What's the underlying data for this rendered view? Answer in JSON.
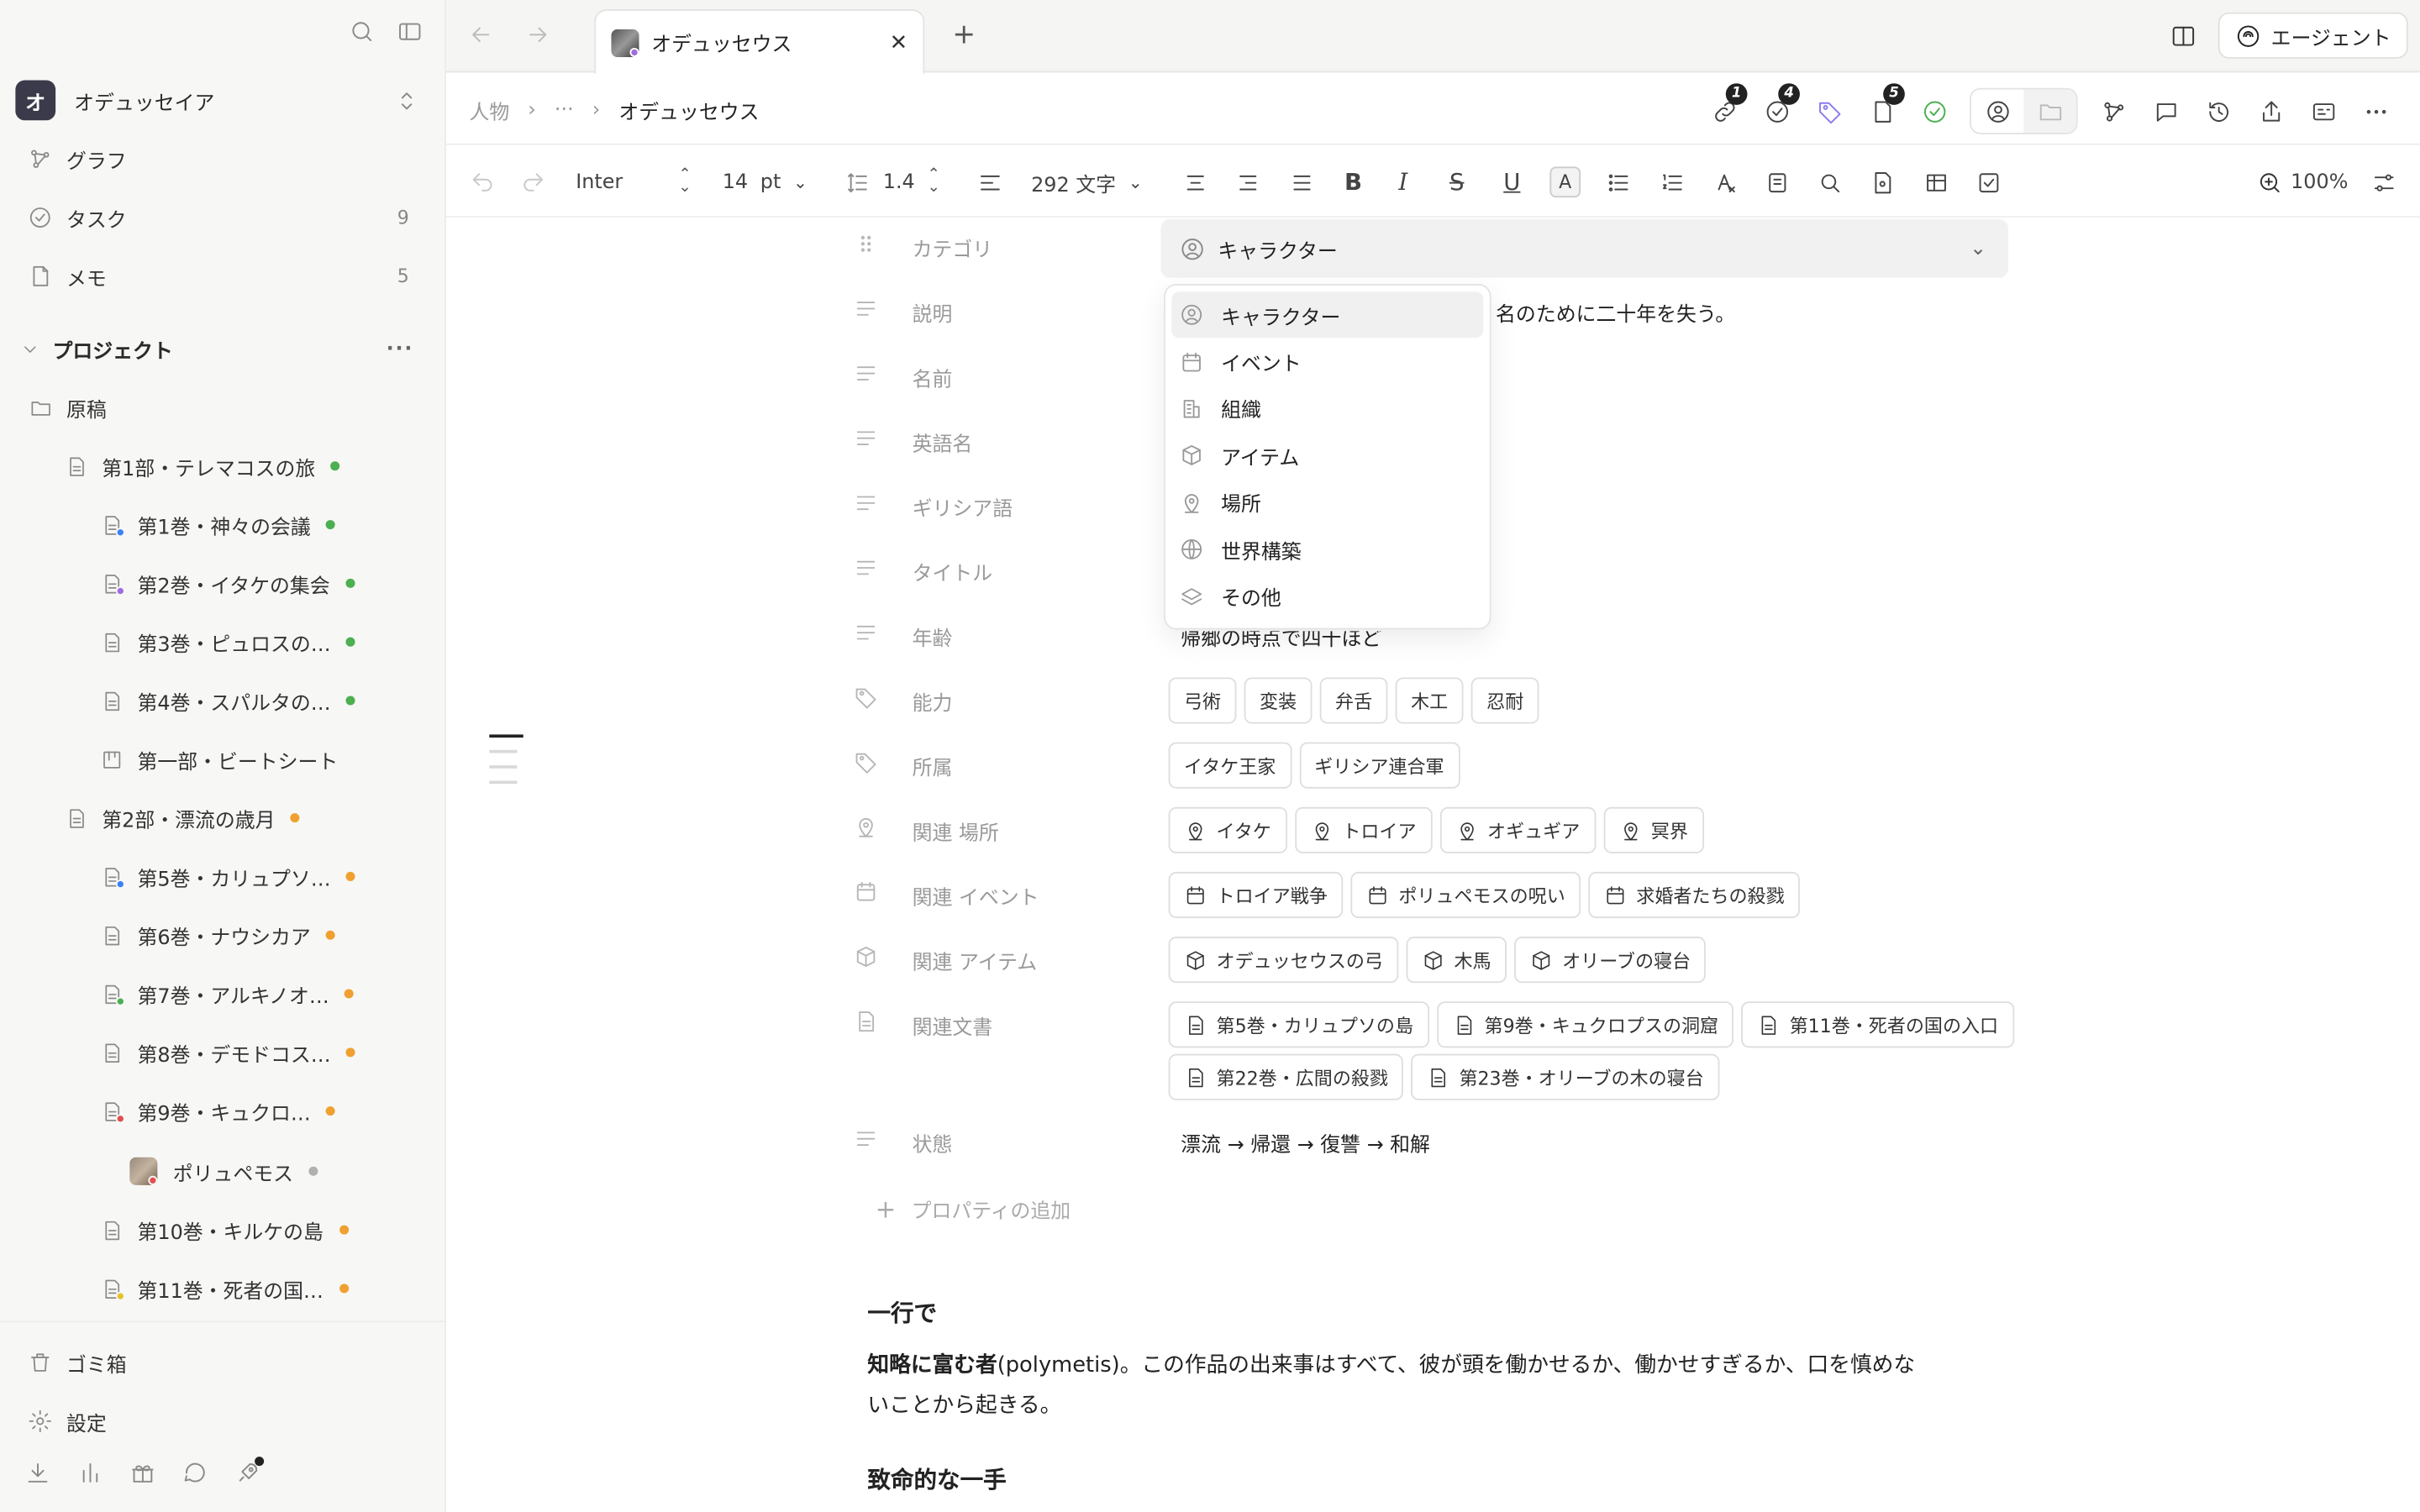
{
  "sidebar": {
    "workspace": {
      "initial": "オ",
      "name": "オデュッセイア"
    },
    "nav": [
      {
        "label": "グラフ",
        "count": ""
      },
      {
        "label": "タスク",
        "count": "9"
      },
      {
        "label": "メモ",
        "count": "5"
      }
    ],
    "section": {
      "label": "プロジェクト",
      "more": "···"
    },
    "tree": [
      {
        "label": "原稿"
      },
      {
        "label": "第1部・テレマコスの旅"
      },
      {
        "label": "第1巻・神々の会議"
      },
      {
        "label": "第2巻・イタケの集会"
      },
      {
        "label": "第3巻・ピュロスの…"
      },
      {
        "label": "第4巻・スパルタの…"
      },
      {
        "label": "第一部・ビートシート"
      },
      {
        "label": "第2部・漂流の歳月"
      },
      {
        "label": "第5巻・カリュプソ…"
      },
      {
        "label": "第6巻・ナウシカア"
      },
      {
        "label": "第7巻・アルキノオ…"
      },
      {
        "label": "第8巻・デモドコス…"
      },
      {
        "label": "第9巻・キュクロ…"
      },
      {
        "label": "ポリュペモス"
      },
      {
        "label": "第10巻・キルケの島"
      },
      {
        "label": "第11巻・死者の国…"
      }
    ],
    "bottom": [
      {
        "label": "ゴミ箱"
      },
      {
        "label": "設定"
      }
    ]
  },
  "tabbar": {
    "tab_title": "オデュッセウス",
    "tab_close": "✕",
    "new_tab": "+",
    "agent_label": "エージェント"
  },
  "pathbar": {
    "crumbs": [
      "人物",
      "···",
      "オデュッセウス"
    ],
    "badges": {
      "links": "1",
      "tasks": "4",
      "docs": "5"
    }
  },
  "toolbar": {
    "font": "Inter",
    "size": "14",
    "size_unit": "pt",
    "line_height": "1.4",
    "word_count": "292 文字",
    "zoom": "100%",
    "bold": "B",
    "italic": "I",
    "strike": "S",
    "underline": "U",
    "color": "A"
  },
  "properties": {
    "category": {
      "label": "カテゴリ",
      "value": "キャラクター"
    },
    "description": {
      "label": "説明",
      "value": "名のために二十年を失う。"
    },
    "name": {
      "label": "名前"
    },
    "english_name": {
      "label": "英語名"
    },
    "greek": {
      "label": "ギリシア語"
    },
    "title": {
      "label": "タイトル"
    },
    "age": {
      "label": "年齢",
      "value": "帰郷の時点で四十ほど"
    },
    "abilities": {
      "label": "能力",
      "chips": [
        "弓術",
        "変装",
        "弁舌",
        "木工",
        "忍耐"
      ]
    },
    "affiliation": {
      "label": "所属",
      "chips": [
        "イタケ王家",
        "ギリシア連合軍"
      ]
    },
    "places": {
      "label": "関連 場所",
      "chips": [
        "イタケ",
        "トロイア",
        "オギュギア",
        "冥界"
      ]
    },
    "events": {
      "label": "関連 イベント",
      "chips": [
        "トロイア戦争",
        "ポリュペモスの呪い",
        "求婚者たちの殺戮"
      ]
    },
    "items": {
      "label": "関連 アイテム",
      "chips": [
        "オデュッセウスの弓",
        "木馬",
        "オリーブの寝台"
      ]
    },
    "docs": {
      "label": "関連文書",
      "chips_row1": [
        "第5巻・カリュプソの島",
        "第9巻・キュクロプスの洞窟",
        "第11巻・死者の国の入口"
      ],
      "chips_row2": [
        "第22巻・広間の殺戮",
        "第23巻・オリーブの木の寝台"
      ]
    },
    "state": {
      "label": "状態",
      "value": "漂流 → 帰還 → 復讐 → 和解"
    },
    "add_label": "プロパティの追加"
  },
  "dropdown": {
    "options": [
      "キャラクター",
      "イベント",
      "組織",
      "アイテム",
      "場所",
      "世界構築",
      "その他"
    ]
  },
  "body": {
    "heading1": "一行で",
    "para1_bold": "知略に富む者",
    "para1_rest": "(polymetis)。この作品の出来事はすべて、彼が頭を働かせるか、働かせすぎるか、口を慎めないことから起きる。",
    "heading2": "致命的な一手"
  },
  "colors": {
    "green": "#4caf50",
    "orange": "#f0a030",
    "blue": "#3b82f6",
    "purple": "#a06be0",
    "red": "#e05050",
    "gray": "#b0b0b0",
    "yellow": "#e6c229"
  }
}
